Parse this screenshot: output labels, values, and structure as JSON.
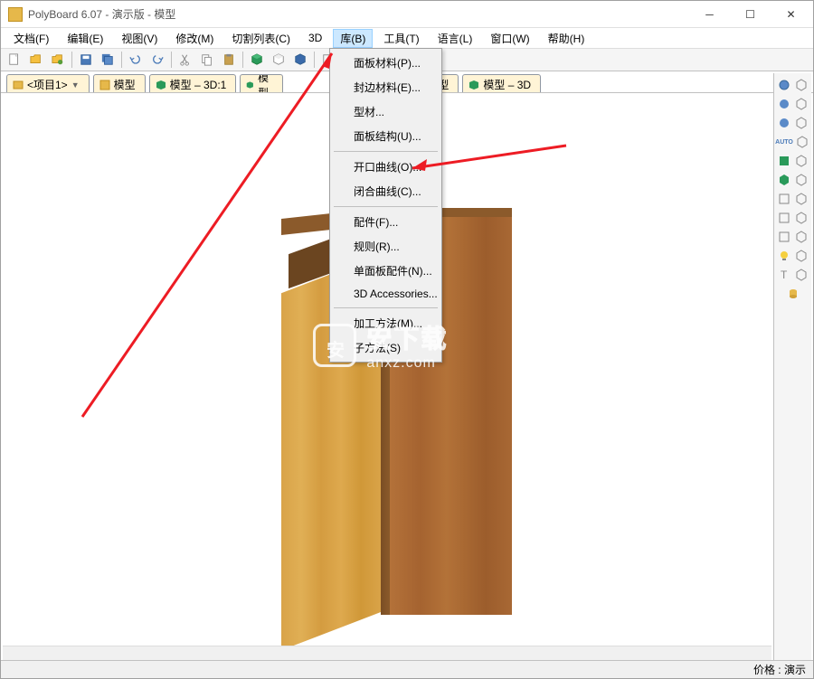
{
  "window": {
    "title": "PolyBoard 6.07 - 演示版 - 模型"
  },
  "menubar": {
    "file": "文档(F)",
    "edit": "编辑(E)",
    "view": "视图(V)",
    "modify": "修改(M)",
    "cutlist": "切割列表(C)",
    "threed": "3D",
    "library": "库(B)",
    "tools": "工具(T)",
    "language": "语言(L)",
    "window": "窗口(W)",
    "help": "帮助(H)"
  },
  "dropdown": {
    "panel_material": "面板材料(P)...",
    "edge_material": "封边材料(E)...",
    "profile": "型材...",
    "panel_structure": "面板结构(U)...",
    "open_curve": "开口曲线(O)...",
    "closed_curve": "闭合曲线(C)...",
    "fitting": "配件(F)...",
    "rule": "规则(R)...",
    "single_panel_fitting": "单面板配件(N)...",
    "3d_accessories": "3D Accessories...",
    "machining_method": "加工方法(M)...",
    "sub_method": "子方法(S)"
  },
  "tabs": {
    "project": "<项目1>",
    "model1": "模型",
    "model_3d1": "模型 – 3D:1",
    "model_partial": "模型",
    "model2": "模型",
    "model_3d": "模型 – 3D"
  },
  "statusbar": {
    "price_label": "价格 :",
    "price_value": "演示"
  },
  "colors": {
    "accent": "#cce8ff",
    "wood_front": "#a56330",
    "wood_side": "#d9a348",
    "arrow": "#ed1c24"
  }
}
